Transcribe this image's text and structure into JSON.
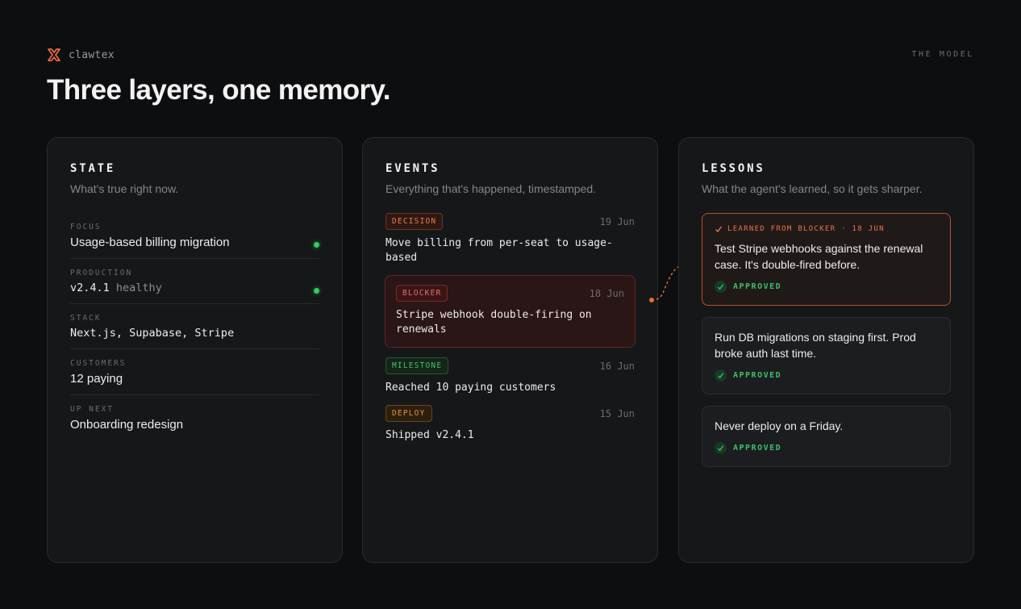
{
  "brand": {
    "logo_icon": "bracket-x-logo",
    "name": "clawtex",
    "accent": "#ee6a3c"
  },
  "top_right_label": "THE MODEL",
  "headline": "Three layers, one memory.",
  "state": {
    "title": "STATE",
    "subtitle": "What's true right now.",
    "rows": [
      {
        "label": "FOCUS",
        "value": "Usage-based billing migration",
        "status": "green"
      },
      {
        "label": "PRODUCTION",
        "value": "v2.4.1",
        "suffix": "healthy",
        "status": "green"
      },
      {
        "label": "STACK",
        "value": "Next.js, Supabase, Stripe"
      },
      {
        "label": "CUSTOMERS",
        "value": "12 paying"
      },
      {
        "label": "UP NEXT",
        "value": "Onboarding redesign"
      }
    ]
  },
  "events": {
    "title": "EVENTS",
    "subtitle": "Everything that's happened, timestamped.",
    "items": [
      {
        "tag": "DECISION",
        "date": "19 Jun",
        "text": "Move billing from per-seat to usage-based"
      },
      {
        "tag": "BLOCKER",
        "date": "18 Jun",
        "text": "Stripe webhook double-firing on renewals"
      },
      {
        "tag": "MILESTONE",
        "date": "16 Jun",
        "text": "Reached 10 paying customers"
      },
      {
        "tag": "DEPLOY",
        "date": "15 Jun",
        "text": "Shipped v2.4.1"
      }
    ]
  },
  "lessons": {
    "title": "LESSONS",
    "subtitle": "What the agent's learned, so it gets sharper.",
    "items": [
      {
        "kicker": "LEARNED FROM BLOCKER · 18 JUN",
        "text": "Test Stripe webhooks against the renewal case. It's double-fired before.",
        "status": "APPROVED"
      },
      {
        "text": "Run DB migrations on staging first. Prod broke auth last time.",
        "status": "APPROVED"
      },
      {
        "text": "Never deploy on a Friday.",
        "status": "APPROVED"
      }
    ]
  },
  "colors": {
    "accent": "#ee6a3c",
    "green": "#2fcf62",
    "blocker": "#f06a6a"
  }
}
